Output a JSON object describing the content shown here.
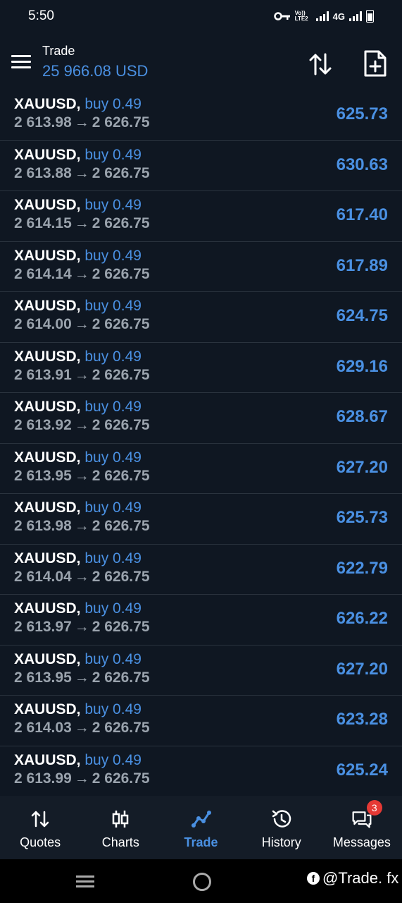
{
  "status": {
    "time": "5:50",
    "network": "4G",
    "volte": "Vo)) LTE2"
  },
  "header": {
    "title": "Trade",
    "balance": "25 966.08 USD"
  },
  "positions": [
    {
      "symbol": "XAUUSD,",
      "side": "buy 0.49",
      "open": "2 613.98",
      "current": "2 626.75",
      "profit": "625.73"
    },
    {
      "symbol": "XAUUSD,",
      "side": "buy 0.49",
      "open": "2 613.88",
      "current": "2 626.75",
      "profit": "630.63"
    },
    {
      "symbol": "XAUUSD,",
      "side": "buy 0.49",
      "open": "2 614.15",
      "current": "2 626.75",
      "profit": "617.40"
    },
    {
      "symbol": "XAUUSD,",
      "side": "buy 0.49",
      "open": "2 614.14",
      "current": "2 626.75",
      "profit": "617.89"
    },
    {
      "symbol": "XAUUSD,",
      "side": "buy 0.49",
      "open": "2 614.00",
      "current": "2 626.75",
      "profit": "624.75"
    },
    {
      "symbol": "XAUUSD,",
      "side": "buy 0.49",
      "open": "2 613.91",
      "current": "2 626.75",
      "profit": "629.16"
    },
    {
      "symbol": "XAUUSD,",
      "side": "buy 0.49",
      "open": "2 613.92",
      "current": "2 626.75",
      "profit": "628.67"
    },
    {
      "symbol": "XAUUSD,",
      "side": "buy 0.49",
      "open": "2 613.95",
      "current": "2 626.75",
      "profit": "627.20"
    },
    {
      "symbol": "XAUUSD,",
      "side": "buy 0.49",
      "open": "2 613.98",
      "current": "2 626.75",
      "profit": "625.73"
    },
    {
      "symbol": "XAUUSD,",
      "side": "buy 0.49",
      "open": "2 614.04",
      "current": "2 626.75",
      "profit": "622.79"
    },
    {
      "symbol": "XAUUSD,",
      "side": "buy 0.49",
      "open": "2 613.97",
      "current": "2 626.75",
      "profit": "626.22"
    },
    {
      "symbol": "XAUUSD,",
      "side": "buy 0.49",
      "open": "2 613.95",
      "current": "2 626.75",
      "profit": "627.20"
    },
    {
      "symbol": "XAUUSD,",
      "side": "buy 0.49",
      "open": "2 614.03",
      "current": "2 626.75",
      "profit": "623.28"
    },
    {
      "symbol": "XAUUSD,",
      "side": "buy 0.49",
      "open": "2 613.99",
      "current": "2 626.75",
      "profit": "625.24"
    }
  ],
  "nav": [
    {
      "label": "Quotes",
      "icon": "quotes-icon"
    },
    {
      "label": "Charts",
      "icon": "charts-icon"
    },
    {
      "label": "Trade",
      "icon": "trade-icon",
      "active": true
    },
    {
      "label": "History",
      "icon": "history-icon"
    },
    {
      "label": "Messages",
      "icon": "messages-icon",
      "badge": "3"
    }
  ],
  "watermark": "@Trade. fx",
  "colors": {
    "background": "#0f1722",
    "accent": "#4a90e2",
    "muted": "#9aa3ad",
    "badge": "#e53935"
  }
}
